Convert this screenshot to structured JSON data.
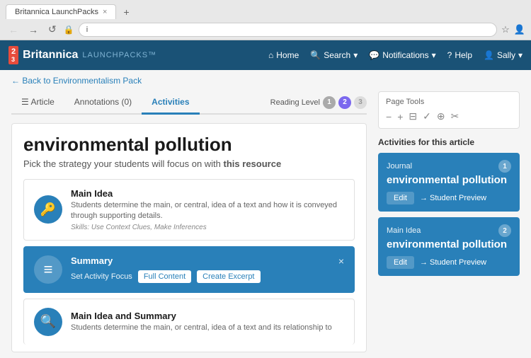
{
  "browser": {
    "tab_title": "Britannica LaunchPacks",
    "tab_close": "×",
    "new_tab": "+",
    "back_btn": "←",
    "forward_btn": "→",
    "refresh_btn": "↺",
    "lock_icon": "🔒",
    "address": "i",
    "star_icon": "☆",
    "user_icon": "👤"
  },
  "topnav": {
    "logo_text": "2 3",
    "brand_name": "Britannica",
    "brand_sub": "LAUNCHPACKS™",
    "home_label": "Home",
    "search_label": "Search",
    "search_arrow": "▾",
    "notifications_label": "Notifications",
    "notifications_arrow": "▾",
    "help_label": "Help",
    "user_label": "Sally",
    "user_arrow": "▾"
  },
  "breadcrumb": {
    "link_text": "Back to Environmentalism Pack"
  },
  "tabs": {
    "article_label": "Article",
    "annotations_label": "Annotations (0)",
    "activities_label": "Activities",
    "reading_level_label": "Reading Level",
    "rl_1": "1",
    "rl_2": "2",
    "rl_3": "3"
  },
  "article": {
    "title": "environmental pollution",
    "subtitle": "Pick the strategy your students will focus on with",
    "subtitle_bold": "this resource"
  },
  "activities": [
    {
      "name": "Main Idea",
      "desc": "Students determine the main, or central, idea of a text and how it is conveyed through supporting details.",
      "skills": "Skills: Use Context Clues, Make Inferences",
      "icon": "🔑",
      "selected": false
    },
    {
      "name": "Summary",
      "set_focus_label": "Set Activity Focus",
      "full_content_btn": "Full Content",
      "create_excerpt_btn": "Create Excerpt",
      "icon": "≡",
      "selected": true
    },
    {
      "name": "Main Idea and Summary",
      "desc": "Students determine the main, or central, idea of a text and its relationship to",
      "icon": "🔍",
      "selected": false
    }
  ],
  "page_tools": {
    "title": "Page Tools",
    "minus": "−",
    "plus": "+",
    "print": "⊟",
    "check": "✓",
    "globe": "⊕",
    "scissors": "✂"
  },
  "activities_sidebar": {
    "title": "Activities for this article",
    "cards": [
      {
        "type": "Journal",
        "title": "environmental pollution",
        "badge": "1",
        "edit_btn": "Edit",
        "preview_btn": "→ Student Preview"
      },
      {
        "type": "Main Idea",
        "title": "environmental pollution",
        "badge": "2",
        "edit_btn": "Edit",
        "preview_btn": "→ Student Preview"
      }
    ]
  }
}
